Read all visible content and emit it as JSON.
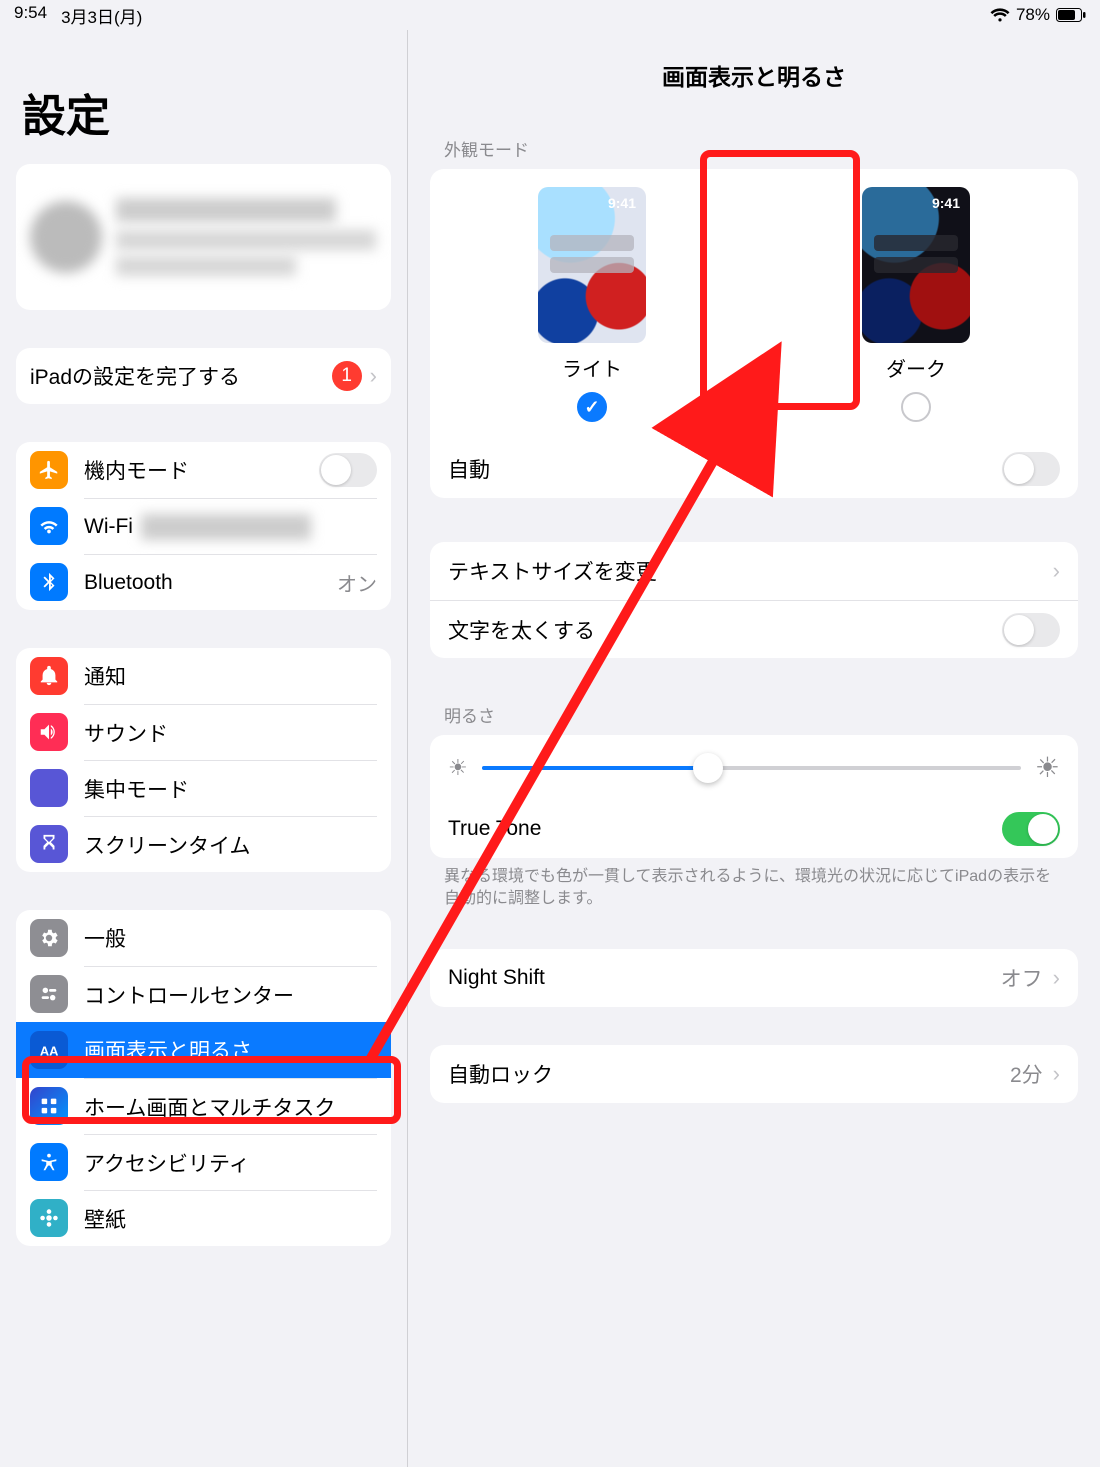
{
  "status": {
    "time": "9:54",
    "date": "3月3日(月)",
    "battery_pct": "78%"
  },
  "sidebar": {
    "title": "設定",
    "finish_setup": {
      "label": "iPadの設定を完了する",
      "badge": "1"
    },
    "g1": {
      "airplane": "機内モード",
      "wifi": "Wi-Fi",
      "bluetooth": "Bluetooth",
      "bluetooth_val": "オン"
    },
    "g2": {
      "notif": "通知",
      "sound": "サウンド",
      "focus": "集中モード",
      "screentime": "スクリーンタイム"
    },
    "g3": {
      "general": "一般",
      "control": "コントロールセンター",
      "display": "画面表示と明るさ",
      "home": "ホーム画面とマルチタスク",
      "access": "アクセシビリティ",
      "wallpaper": "壁紙"
    }
  },
  "detail": {
    "title": "画面表示と明るさ",
    "appearance_header": "外観モード",
    "light": "ライト",
    "dark": "ダーク",
    "thumb_time": "9:41",
    "auto": "自動",
    "text_size": "テキストサイズを変更",
    "bold": "文字を太くする",
    "brightness_header": "明るさ",
    "truetone": "True Tone",
    "truetone_footer": "異なる環境でも色が一貫して表示されるように、環境光の状況に応じてiPadの表示を自動的に調整します。",
    "nightshift": "Night Shift",
    "nightshift_val": "オフ",
    "autolock": "自動ロック",
    "autolock_val": "2分",
    "brightness_pct": 42
  }
}
